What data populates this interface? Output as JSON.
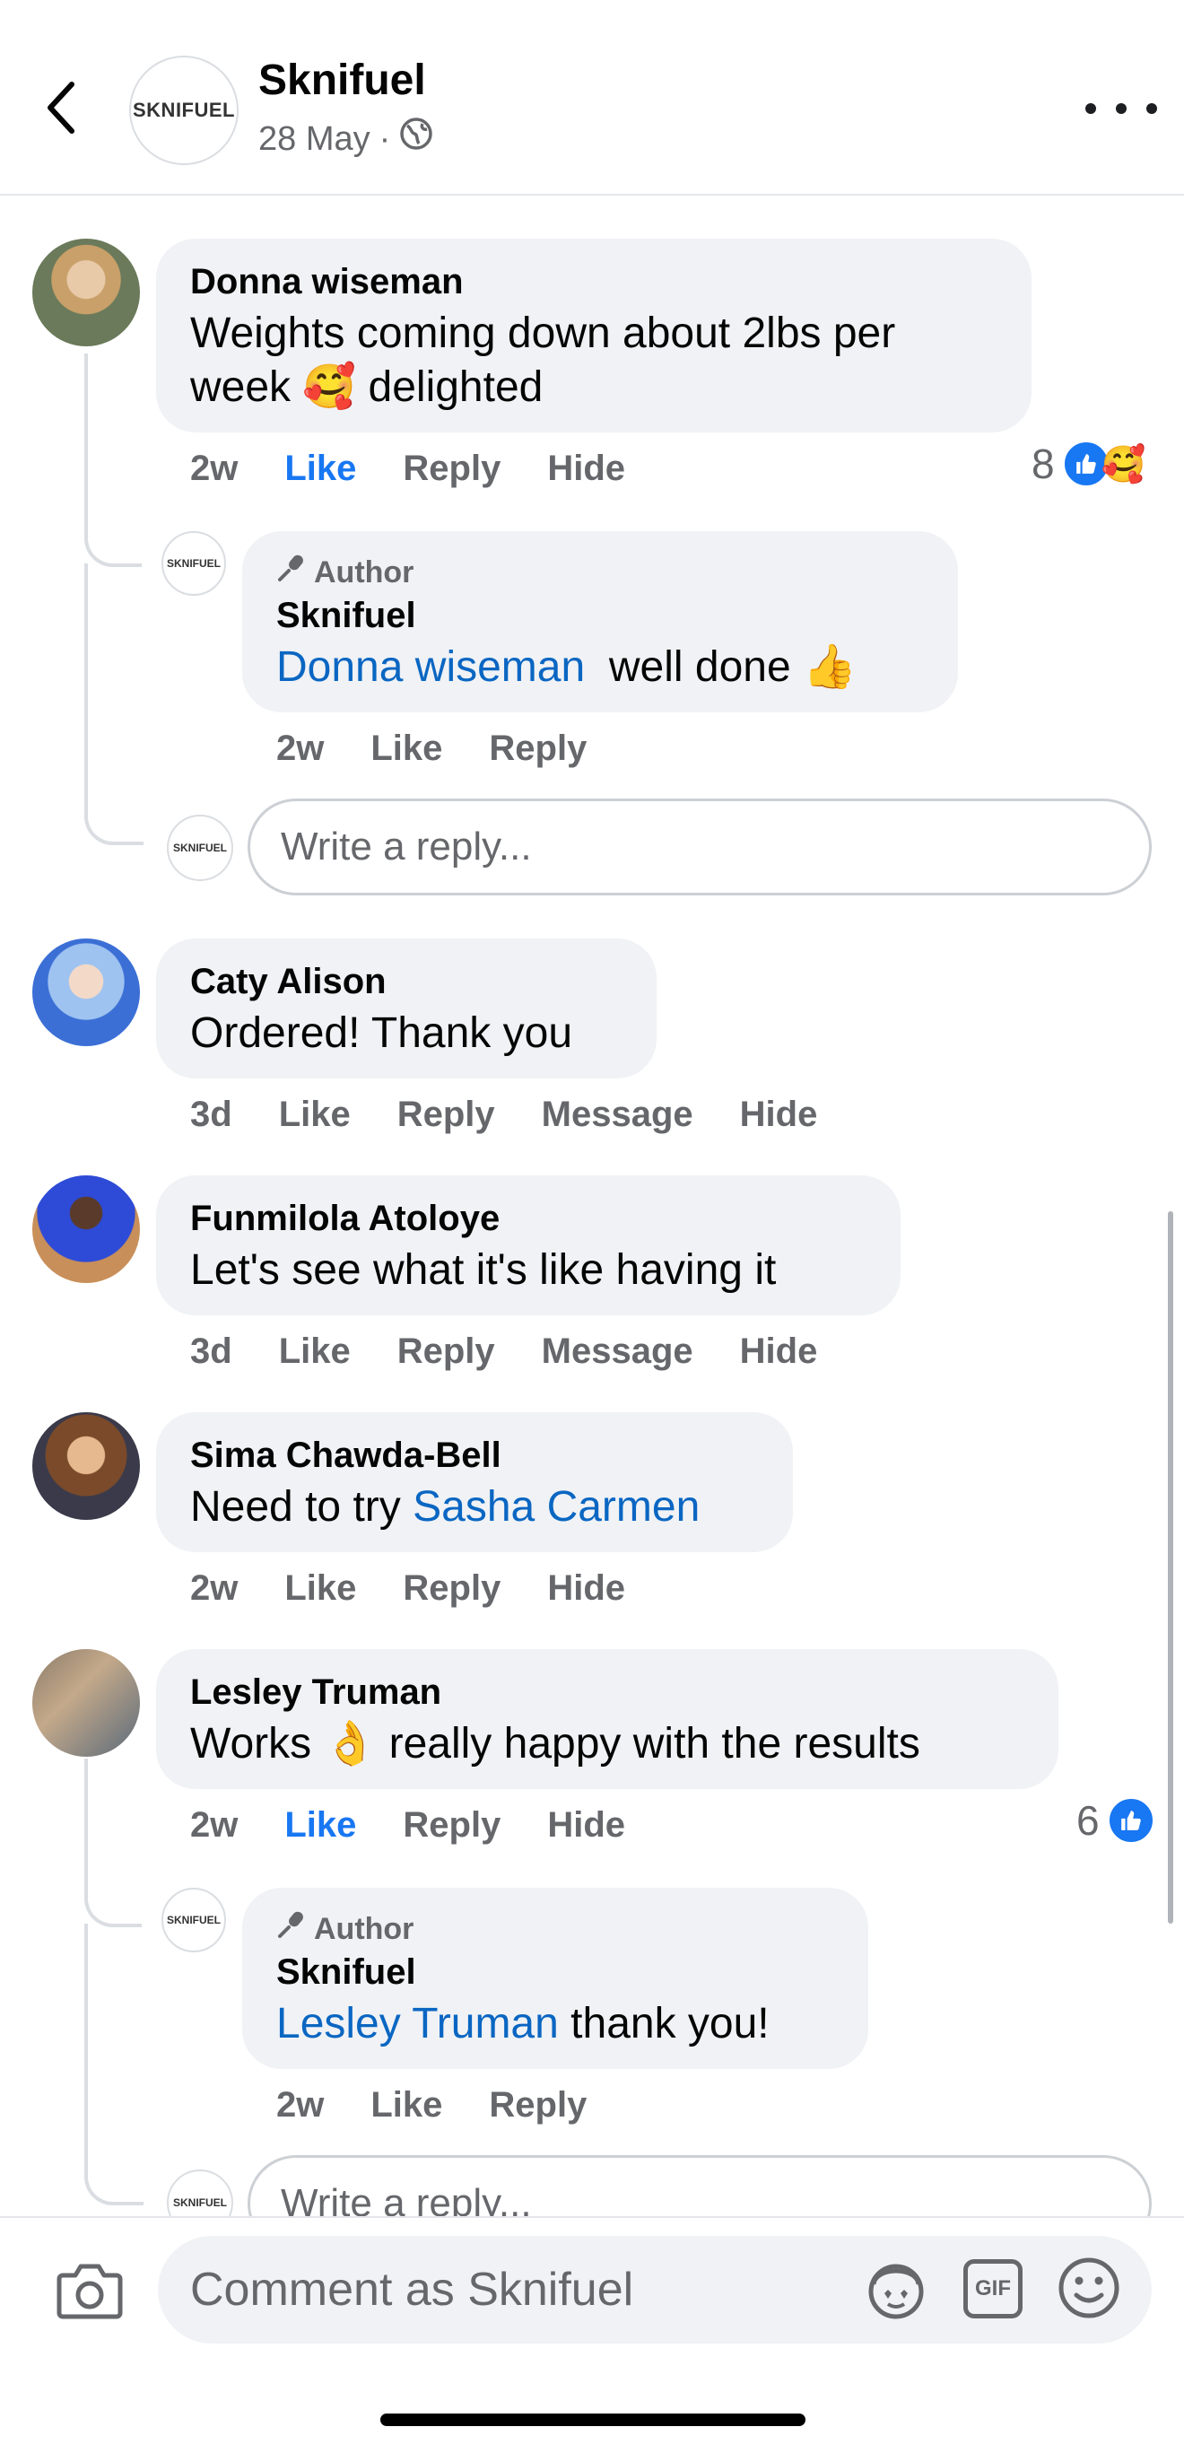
{
  "header": {
    "title": "Sknifuel",
    "date": "28 May",
    "separator": "·",
    "avatar_text": "SKNIFUEL"
  },
  "comments": [
    {
      "author": "Donna wiseman",
      "text_line1": "Weights coming down about 2lbs per",
      "text_line2_a": "week",
      "emoji": "🥰",
      "text_line2_b": "delighted",
      "time": "2w",
      "like": "Like",
      "reply": "Reply",
      "hide": "Hide",
      "reaction_count": "8",
      "reaction_emoji": "🥰",
      "replies": {
        "author_tag": "Author",
        "author": "Sknifuel",
        "mention": "Donna wiseman",
        "text": "well done",
        "emoji": "👍",
        "time": "2w",
        "like": "Like",
        "reply": "Reply",
        "avatar_text": "SKNIFUEL"
      },
      "reply_input_placeholder": "Write a reply..."
    },
    {
      "author": "Caty Alison",
      "text": "Ordered! Thank you",
      "time": "3d",
      "like": "Like",
      "reply": "Reply",
      "message": "Message",
      "hide": "Hide"
    },
    {
      "author": "Funmilola Atoloye",
      "text": "Let's see what it's like having it",
      "time": "3d",
      "like": "Like",
      "reply": "Reply",
      "message": "Message",
      "hide": "Hide"
    },
    {
      "author": "Sima Chawda-Bell",
      "text": "Need to try",
      "mention": "Sasha Carmen",
      "time": "2w",
      "like": "Like",
      "reply": "Reply",
      "hide": "Hide"
    },
    {
      "author": "Lesley Truman",
      "text_a": "Works",
      "emoji": "👌",
      "text_b": "really happy with the results",
      "time": "2w",
      "like": "Like",
      "reply": "Reply",
      "hide": "Hide",
      "reaction_count": "6",
      "replies": {
        "author_tag": "Author",
        "author": "Sknifuel",
        "mention": "Lesley Truman",
        "text": "thank you!",
        "time": "2w",
        "like": "Like",
        "reply": "Reply",
        "avatar_text": "SKNIFUEL"
      },
      "reply_input_placeholder": "Write a reply..."
    }
  ],
  "composer": {
    "placeholder": "Comment as Sknifuel",
    "gif_label": "GIF"
  },
  "colors": {
    "accent": "#1877f2",
    "mention": "#0a66c2",
    "bubble": "#f0f2f5",
    "secondary_text": "#65676b"
  }
}
